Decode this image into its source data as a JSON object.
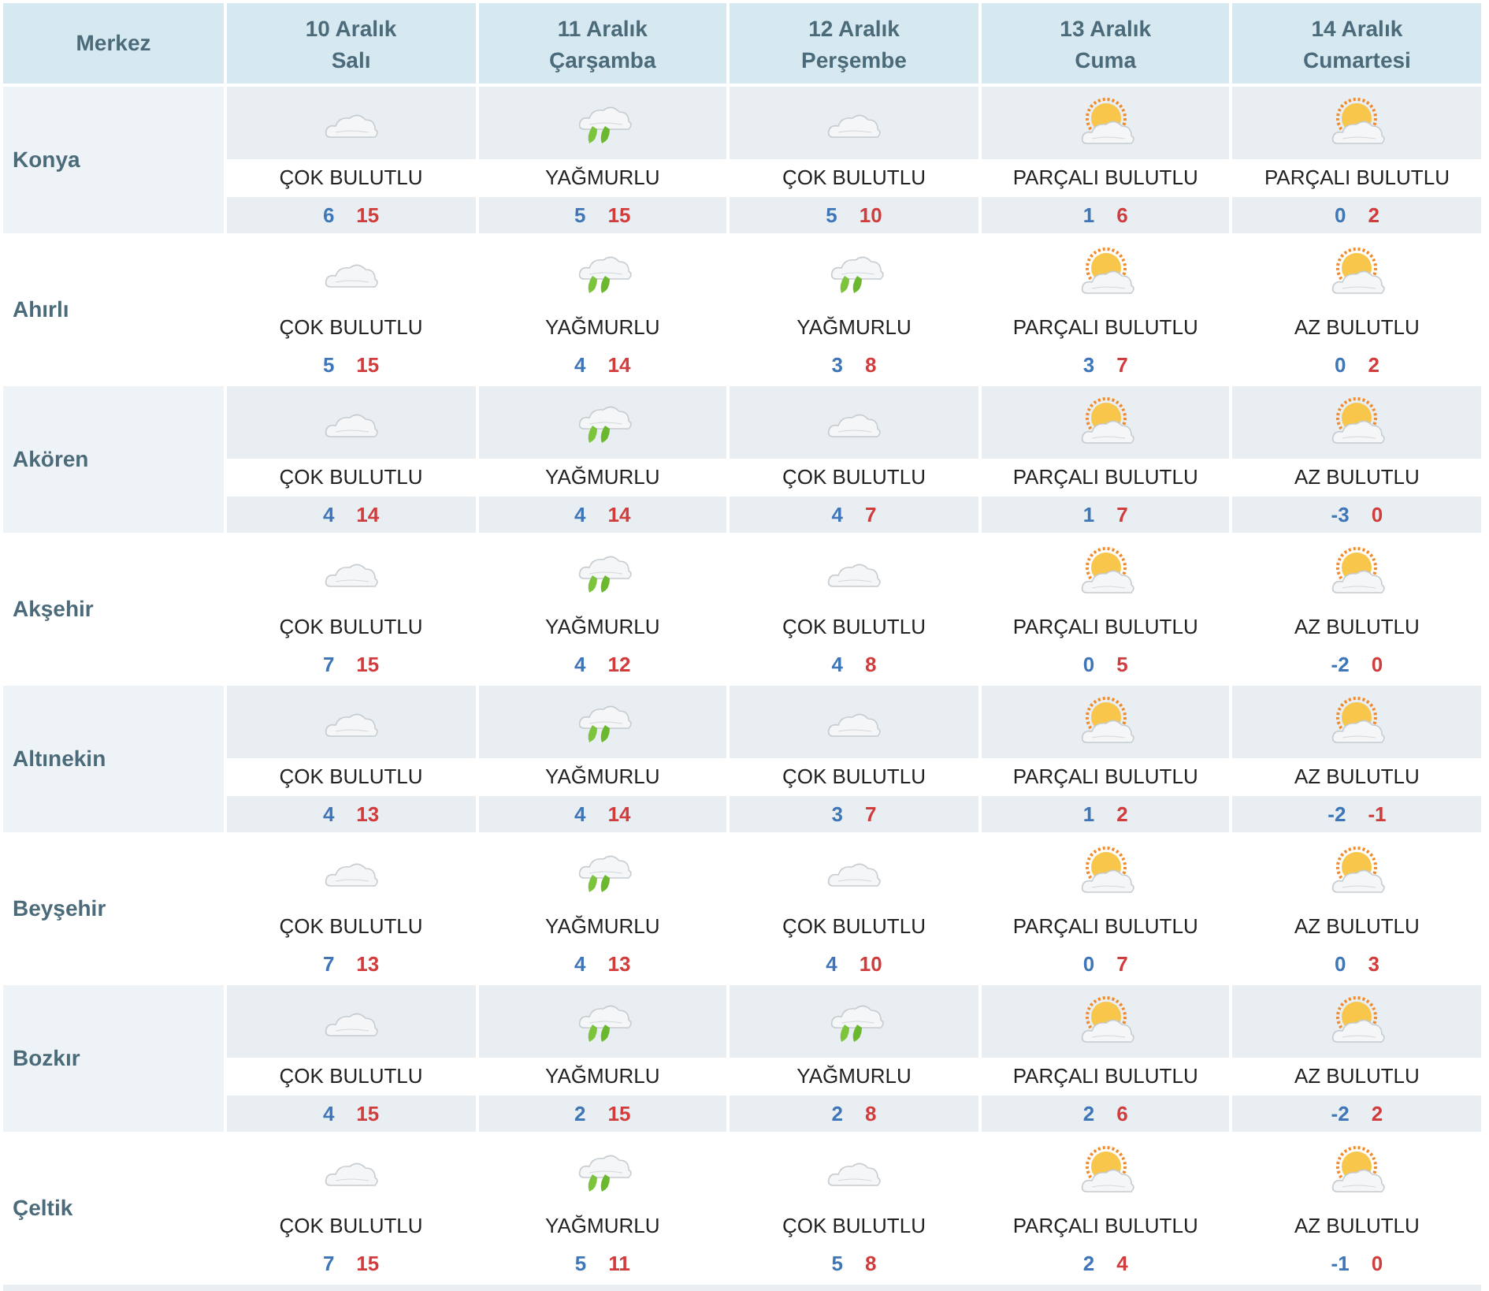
{
  "header": {
    "first": "Merkez",
    "days": [
      {
        "date": "10 Aralık",
        "weekday": "Salı"
      },
      {
        "date": "11 Aralık",
        "weekday": "Çarşamba"
      },
      {
        "date": "12 Aralık",
        "weekday": "Perşembe"
      },
      {
        "date": "13 Aralık",
        "weekday": "Cuma"
      },
      {
        "date": "14 Aralık",
        "weekday": "Cumartesi"
      }
    ]
  },
  "cities": [
    {
      "name": "Konya",
      "forecasts": [
        {
          "kind": "cloudy",
          "desc": "ÇOK BULUTLU",
          "low": "6",
          "high": "15"
        },
        {
          "kind": "rain",
          "desc": "YAĞMURLU",
          "low": "5",
          "high": "15"
        },
        {
          "kind": "cloudy",
          "desc": "ÇOK BULUTLU",
          "low": "5",
          "high": "10"
        },
        {
          "kind": "partly",
          "desc": "PARÇALI BULUTLU",
          "low": "1",
          "high": "6"
        },
        {
          "kind": "partly",
          "desc": "PARÇALI BULUTLU",
          "low": "0",
          "high": "2"
        }
      ]
    },
    {
      "name": "Ahırlı",
      "forecasts": [
        {
          "kind": "cloudy",
          "desc": "ÇOK BULUTLU",
          "low": "5",
          "high": "15"
        },
        {
          "kind": "rain",
          "desc": "YAĞMURLU",
          "low": "4",
          "high": "14"
        },
        {
          "kind": "rain",
          "desc": "YAĞMURLU",
          "low": "3",
          "high": "8"
        },
        {
          "kind": "partly",
          "desc": "PARÇALI BULUTLU",
          "low": "3",
          "high": "7"
        },
        {
          "kind": "partly",
          "desc": "AZ BULUTLU",
          "low": "0",
          "high": "2"
        }
      ]
    },
    {
      "name": "Akören",
      "forecasts": [
        {
          "kind": "cloudy",
          "desc": "ÇOK BULUTLU",
          "low": "4",
          "high": "14"
        },
        {
          "kind": "rain",
          "desc": "YAĞMURLU",
          "low": "4",
          "high": "14"
        },
        {
          "kind": "cloudy",
          "desc": "ÇOK BULUTLU",
          "low": "4",
          "high": "7"
        },
        {
          "kind": "partly",
          "desc": "PARÇALI BULUTLU",
          "low": "1",
          "high": "7"
        },
        {
          "kind": "partly",
          "desc": "AZ BULUTLU",
          "low": "-3",
          "high": "0"
        }
      ]
    },
    {
      "name": "Akşehir",
      "forecasts": [
        {
          "kind": "cloudy",
          "desc": "ÇOK BULUTLU",
          "low": "7",
          "high": "15"
        },
        {
          "kind": "rain",
          "desc": "YAĞMURLU",
          "low": "4",
          "high": "12"
        },
        {
          "kind": "cloudy",
          "desc": "ÇOK BULUTLU",
          "low": "4",
          "high": "8"
        },
        {
          "kind": "partly",
          "desc": "PARÇALI BULUTLU",
          "low": "0",
          "high": "5"
        },
        {
          "kind": "partly",
          "desc": "AZ BULUTLU",
          "low": "-2",
          "high": "0"
        }
      ]
    },
    {
      "name": "Altınekin",
      "forecasts": [
        {
          "kind": "cloudy",
          "desc": "ÇOK BULUTLU",
          "low": "4",
          "high": "13"
        },
        {
          "kind": "rain",
          "desc": "YAĞMURLU",
          "low": "4",
          "high": "14"
        },
        {
          "kind": "cloudy",
          "desc": "ÇOK BULUTLU",
          "low": "3",
          "high": "7"
        },
        {
          "kind": "partly",
          "desc": "PARÇALI BULUTLU",
          "low": "1",
          "high": "2"
        },
        {
          "kind": "partly",
          "desc": "AZ BULUTLU",
          "low": "-2",
          "high": "-1"
        }
      ]
    },
    {
      "name": "Beyşehir",
      "forecasts": [
        {
          "kind": "cloudy",
          "desc": "ÇOK BULUTLU",
          "low": "7",
          "high": "13"
        },
        {
          "kind": "rain",
          "desc": "YAĞMURLU",
          "low": "4",
          "high": "13"
        },
        {
          "kind": "cloudy",
          "desc": "ÇOK BULUTLU",
          "low": "4",
          "high": "10"
        },
        {
          "kind": "partly",
          "desc": "PARÇALI BULUTLU",
          "low": "0",
          "high": "7"
        },
        {
          "kind": "partly",
          "desc": "AZ BULUTLU",
          "low": "0",
          "high": "3"
        }
      ]
    },
    {
      "name": "Bozkır",
      "forecasts": [
        {
          "kind": "cloudy",
          "desc": "ÇOK BULUTLU",
          "low": "4",
          "high": "15"
        },
        {
          "kind": "rain",
          "desc": "YAĞMURLU",
          "low": "2",
          "high": "15"
        },
        {
          "kind": "rain",
          "desc": "YAĞMURLU",
          "low": "2",
          "high": "8"
        },
        {
          "kind": "partly",
          "desc": "PARÇALI BULUTLU",
          "low": "2",
          "high": "6"
        },
        {
          "kind": "partly",
          "desc": "AZ BULUTLU",
          "low": "-2",
          "high": "2"
        }
      ]
    },
    {
      "name": "Çeltik",
      "forecasts": [
        {
          "kind": "cloudy",
          "desc": "ÇOK BULUTLU",
          "low": "7",
          "high": "15"
        },
        {
          "kind": "rain",
          "desc": "YAĞMURLU",
          "low": "5",
          "high": "11"
        },
        {
          "kind": "cloudy",
          "desc": "ÇOK BULUTLU",
          "low": "5",
          "high": "8"
        },
        {
          "kind": "partly",
          "desc": "PARÇALI BULUTLU",
          "low": "2",
          "high": "4"
        },
        {
          "kind": "partly",
          "desc": "AZ BULUTLU",
          "low": "-1",
          "high": "0"
        }
      ]
    }
  ]
}
